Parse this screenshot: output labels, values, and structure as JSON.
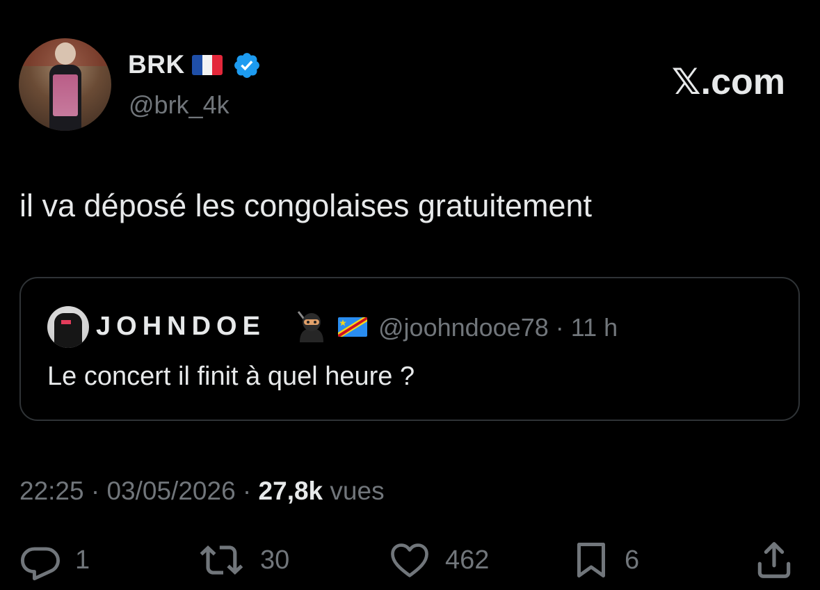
{
  "author": {
    "display_name": "BRK",
    "handle": "@brk_4k",
    "flag": "france-flag",
    "badge": "verified-badge-icon",
    "verified_color": "#1d9bf0"
  },
  "brand": "𝕏.com",
  "tweet": {
    "text": "il va déposé les congolaises gratuitement"
  },
  "quoted_tweet": {
    "display_name": "JOHNDOE",
    "emojis": [
      "ninja-emoji",
      "dr-congo-flag"
    ],
    "handle_time": "@joohndooe78 · 11 h",
    "text": "Le concert il finit à quel heure ?"
  },
  "meta": {
    "time_date": "22:25 · 03/05/2026 · ",
    "views_count": "27,8k",
    "views_label": " vues"
  },
  "actions": {
    "replies": "1",
    "reposts": "30",
    "likes": "462",
    "bookmarks": "6"
  },
  "colors": {
    "background": "#000000",
    "text_primary": "#e7e9ea",
    "text_secondary": "#71767b",
    "border": "#2f3336"
  }
}
